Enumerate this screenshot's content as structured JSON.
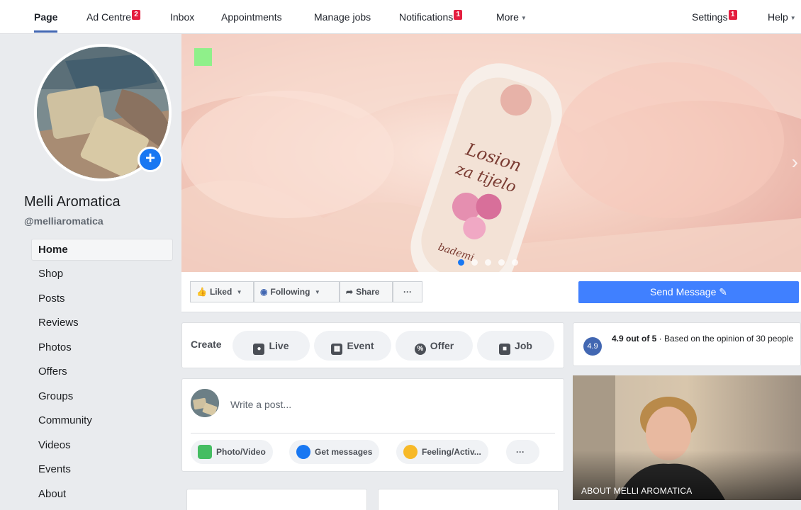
{
  "nav": {
    "items": [
      {
        "label": "Page"
      },
      {
        "label": "Ad Centre",
        "badge": "2"
      },
      {
        "label": "Inbox"
      },
      {
        "label": "Appointments"
      },
      {
        "label": "Manage jobs"
      },
      {
        "label": "Notifications",
        "badge": "1"
      },
      {
        "label": "More"
      }
    ],
    "settings": {
      "label": "Settings",
      "badge": "1"
    },
    "help": {
      "label": "Help"
    }
  },
  "page": {
    "name": "Melli Aromatica",
    "handle": "@melliaromatica"
  },
  "sidebar": {
    "items": [
      "Home",
      "Shop",
      "Posts",
      "Reviews",
      "Photos",
      "Offers",
      "Groups",
      "Community",
      "Videos",
      "Events",
      "About"
    ]
  },
  "cover": {
    "product_line1": "Losion",
    "product_line2": "za tijelo",
    "product_sub": "bademi"
  },
  "actions": {
    "liked": "Liked",
    "following": "Following",
    "share": "Share",
    "more": "···",
    "send_message": "Send Message"
  },
  "create": {
    "label": "Create",
    "buttons": [
      "Live",
      "Event",
      "Offer",
      "Job"
    ]
  },
  "composer": {
    "placeholder": "Write a post...",
    "chips": [
      "Photo/Video",
      "Get messages",
      "Feeling/Activ...",
      "···"
    ]
  },
  "rating": {
    "score": "4.9",
    "headline": "4.9 out of 5",
    "detail": " · Based on the opinion of 30 people"
  },
  "about": {
    "label": "ABOUT MELLI AROMATICA"
  },
  "colors": {
    "accent": "#4267b2",
    "send": "#4080ff",
    "badge": "#e41e3f"
  }
}
